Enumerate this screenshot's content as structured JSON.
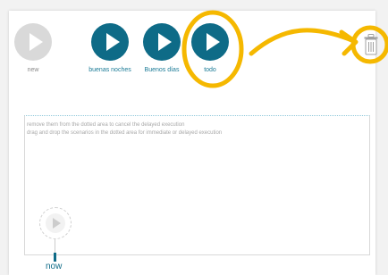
{
  "scenarios": [
    {
      "label": "new",
      "style": "gray"
    },
    {
      "label": "buenas noches",
      "style": "blue"
    },
    {
      "label": "Buenos días",
      "style": "blue"
    },
    {
      "label": "todo",
      "style": "blue"
    }
  ],
  "hints": {
    "line1": "remove them from the dotted area to cancel the delayed execution",
    "line2": "drag and drop the scenarios in the dotted area for immediate or delayed execution"
  },
  "timeline": {
    "now_label": "now"
  },
  "icons": {
    "play": "play-icon",
    "trash": "trash-icon"
  },
  "colors": {
    "accent": "#0e6b87",
    "inactive": "#d9d9d9",
    "label_blue": "#1a7a96",
    "label_gray": "#8a8a8a",
    "annotation": "#f5b800",
    "hint_text": "#a8a8a8"
  }
}
